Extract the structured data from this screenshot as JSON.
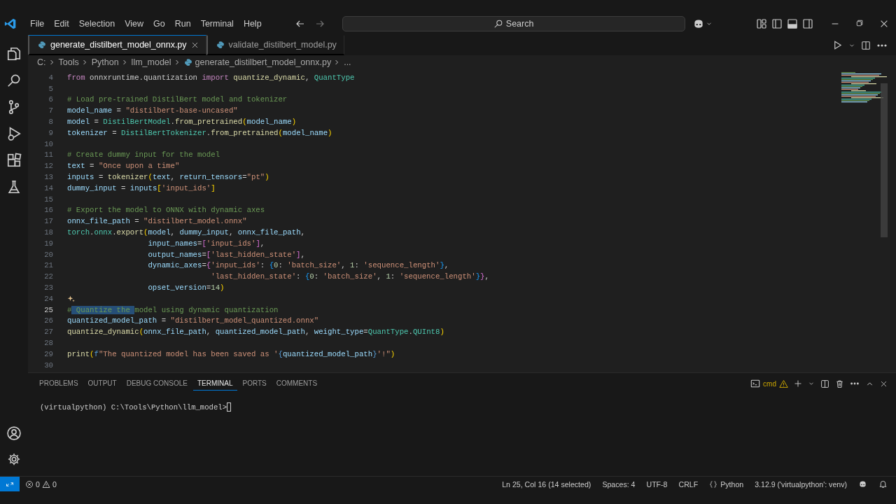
{
  "menu": [
    "File",
    "Edit",
    "Selection",
    "View",
    "Go",
    "Run",
    "Terminal",
    "Help"
  ],
  "search": {
    "placeholder": "Search"
  },
  "tabs": [
    {
      "label": "generate_distilbert_model_onnx.py",
      "selected": true
    },
    {
      "label": "validate_distilbert_model.py",
      "selected": false
    }
  ],
  "breadcrumbs": [
    "C:",
    "Tools",
    "Python",
    "llm_model",
    "generate_distilbert_model_onnx.py",
    "..."
  ],
  "code": [
    {
      "n": "4",
      "current": false,
      "tokens": [
        {
          "text": "from",
          "kind": "kw"
        },
        {
          "text": " onnxruntime.quantization ",
          "kind": "p"
        },
        {
          "text": "import",
          "kind": "kw"
        },
        {
          "text": " quantize_dynamic",
          "kind": "fn"
        },
        {
          "text": ", ",
          "kind": "p"
        },
        {
          "text": "QuantType",
          "kind": "cls"
        }
      ]
    },
    {
      "n": "5",
      "current": false
    },
    {
      "n": "6",
      "current": false,
      "tokens": [
        {
          "text": "# Load pre-trained DistilBert model and tokenizer",
          "kind": "cmt"
        }
      ]
    },
    {
      "n": "7",
      "current": false,
      "tokens": [
        {
          "text": "model_name",
          "kind": "var"
        },
        {
          "text": " = ",
          "kind": "p"
        },
        {
          "text": "\"distilbert-base-uncased\"",
          "kind": "str"
        }
      ]
    },
    {
      "n": "8",
      "current": false,
      "tokens": [
        {
          "text": "model",
          "kind": "var"
        },
        {
          "text": " = ",
          "kind": "p"
        },
        {
          "text": "DistilBertModel",
          "kind": "cls"
        },
        {
          "text": ".",
          "kind": "p"
        },
        {
          "text": "from_pretrained",
          "kind": "fn"
        },
        {
          "text": "(",
          "kind": "b1"
        },
        {
          "text": "model_name",
          "kind": "var"
        },
        {
          "text": ")",
          "kind": "b1"
        }
      ]
    },
    {
      "n": "9",
      "current": false,
      "tokens": [
        {
          "text": "tokenizer",
          "kind": "var"
        },
        {
          "text": " = ",
          "kind": "p"
        },
        {
          "text": "DistilBertTokenizer",
          "kind": "cls"
        },
        {
          "text": ".",
          "kind": "p"
        },
        {
          "text": "from_pretrained",
          "kind": "fn"
        },
        {
          "text": "(",
          "kind": "b1"
        },
        {
          "text": "model_name",
          "kind": "var"
        },
        {
          "text": ")",
          "kind": "b1"
        }
      ]
    },
    {
      "n": "10",
      "current": false
    },
    {
      "n": "11",
      "current": false,
      "tokens": [
        {
          "text": "# Create dummy input for the model",
          "kind": "cmt"
        }
      ]
    },
    {
      "n": "12",
      "current": false,
      "tokens": [
        {
          "text": "text",
          "kind": "var"
        },
        {
          "text": " = ",
          "kind": "p"
        },
        {
          "text": "\"Once upon a time\"",
          "kind": "str"
        }
      ]
    },
    {
      "n": "13",
      "current": false,
      "tokens": [
        {
          "text": "inputs",
          "kind": "var"
        },
        {
          "text": " = ",
          "kind": "p"
        },
        {
          "text": "tokenizer",
          "kind": "fn"
        },
        {
          "text": "(",
          "kind": "b1"
        },
        {
          "text": "text",
          "kind": "var"
        },
        {
          "text": ", ",
          "kind": "p"
        },
        {
          "text": "return_tensors",
          "kind": "var"
        },
        {
          "text": "=",
          "kind": "p"
        },
        {
          "text": "\"pt\"",
          "kind": "str"
        },
        {
          "text": ")",
          "kind": "b1"
        }
      ]
    },
    {
      "n": "14",
      "current": false,
      "tokens": [
        {
          "text": "dummy_input",
          "kind": "var"
        },
        {
          "text": " = ",
          "kind": "p"
        },
        {
          "text": "inputs",
          "kind": "var"
        },
        {
          "text": "[",
          "kind": "b1"
        },
        {
          "text": "'input_ids'",
          "kind": "str"
        },
        {
          "text": "]",
          "kind": "b1"
        }
      ]
    },
    {
      "n": "15",
      "current": false
    },
    {
      "n": "16",
      "current": false,
      "tokens": [
        {
          "text": "# Export the model to ONNX with dynamic axes",
          "kind": "cmt"
        }
      ]
    },
    {
      "n": "17",
      "current": false,
      "tokens": [
        {
          "text": "onnx_file_path",
          "kind": "var"
        },
        {
          "text": " = ",
          "kind": "p"
        },
        {
          "text": "\"distilbert_model.onnx\"",
          "kind": "str"
        }
      ]
    },
    {
      "n": "18",
      "current": false,
      "tokens": [
        {
          "text": "torch",
          "kind": "cls"
        },
        {
          "text": ".",
          "kind": "p"
        },
        {
          "text": "onnx",
          "kind": "cls"
        },
        {
          "text": ".",
          "kind": "p"
        },
        {
          "text": "export",
          "kind": "fn"
        },
        {
          "text": "(",
          "kind": "b1"
        },
        {
          "text": "model",
          "kind": "var"
        },
        {
          "text": ", ",
          "kind": "p"
        },
        {
          "text": "dummy_input",
          "kind": "var"
        },
        {
          "text": ", ",
          "kind": "p"
        },
        {
          "text": "onnx_file_path",
          "kind": "var"
        },
        {
          "text": ",",
          "kind": "p"
        }
      ]
    },
    {
      "n": "19",
      "current": false,
      "kind": "argument",
      "tokens": [
        {
          "text": "input_names",
          "kind": "var"
        },
        {
          "text": "=",
          "kind": "p"
        },
        {
          "text": "[",
          "kind": "b2"
        },
        {
          "text": "'input_ids'",
          "kind": "str"
        },
        {
          "text": "]",
          "kind": "b2"
        },
        {
          "text": ",",
          "kind": "p"
        }
      ]
    },
    {
      "n": "20",
      "current": false,
      "kind": "argument",
      "tokens": [
        {
          "text": "output_names",
          "kind": "var"
        },
        {
          "text": "=",
          "kind": "p"
        },
        {
          "text": "[",
          "kind": "b2"
        },
        {
          "text": "'last_hidden_state'",
          "kind": "str"
        },
        {
          "text": "]",
          "kind": "b2"
        },
        {
          "text": ",",
          "kind": "p"
        }
      ]
    },
    {
      "n": "21",
      "current": false,
      "kind": "argument",
      "tokens": [
        {
          "text": "dynamic_axes",
          "kind": "var"
        },
        {
          "text": "=",
          "kind": "p"
        },
        {
          "text": "{",
          "kind": "b2"
        },
        {
          "text": "'input_ids'",
          "kind": "str"
        },
        {
          "text": ": ",
          "kind": "p"
        },
        {
          "text": "{",
          "kind": "b3"
        },
        {
          "text": "0",
          "kind": "num"
        },
        {
          "text": ": ",
          "kind": "p"
        },
        {
          "text": "'batch_size'",
          "kind": "str"
        },
        {
          "text": ", ",
          "kind": "p"
        },
        {
          "text": "1",
          "kind": "num"
        },
        {
          "text": ": ",
          "kind": "p"
        },
        {
          "text": "'sequence_length'",
          "kind": "str"
        },
        {
          "text": "}",
          "kind": "b3"
        },
        {
          "text": ",",
          "kind": "p"
        }
      ]
    },
    {
      "n": "22",
      "current": false,
      "kind": "nested",
      "tokens": [
        {
          "text": "'last_hidden_state'",
          "kind": "str"
        },
        {
          "text": ": ",
          "kind": "p"
        },
        {
          "text": "{",
          "kind": "b3"
        },
        {
          "text": "0",
          "kind": "num"
        },
        {
          "text": ": ",
          "kind": "p"
        },
        {
          "text": "'batch_size'",
          "kind": "str"
        },
        {
          "text": ", ",
          "kind": "p"
        },
        {
          "text": "1",
          "kind": "num"
        },
        {
          "text": ": ",
          "kind": "p"
        },
        {
          "text": "'sequence_length'",
          "kind": "str"
        },
        {
          "text": "}",
          "kind": "b3"
        },
        {
          "text": "}",
          "kind": "b2"
        },
        {
          "text": ",",
          "kind": "p"
        }
      ]
    },
    {
      "n": "23",
      "current": false,
      "kind": "argument",
      "tokens": [
        {
          "text": "opset_version",
          "kind": "var"
        },
        {
          "text": "=",
          "kind": "p"
        },
        {
          "text": "14",
          "kind": "num"
        },
        {
          "text": ")",
          "kind": "b1"
        }
      ]
    },
    {
      "n": "24",
      "current": false,
      "sparkle": true
    },
    {
      "n": "25",
      "current": true,
      "tokens": [
        {
          "text": "#",
          "kind": "cmt"
        },
        {
          "text": " Quantize the ",
          "kind": "sel"
        },
        {
          "text": "model using dynamic quantization",
          "kind": "cmt"
        }
      ]
    },
    {
      "n": "26",
      "current": false,
      "tokens": [
        {
          "text": "quantized_model_path",
          "kind": "var"
        },
        {
          "text": " = ",
          "kind": "p"
        },
        {
          "text": "\"distilbert_model_quantized.onnx\"",
          "kind": "str"
        }
      ]
    },
    {
      "n": "27",
      "current": false,
      "tokens": [
        {
          "text": "quantize_dynamic",
          "kind": "fn"
        },
        {
          "text": "(",
          "kind": "b1"
        },
        {
          "text": "onnx_file_path",
          "kind": "var"
        },
        {
          "text": ", ",
          "kind": "p"
        },
        {
          "text": "quantized_model_path",
          "kind": "var"
        },
        {
          "text": ", ",
          "kind": "p"
        },
        {
          "text": "weight_type",
          "kind": "var"
        },
        {
          "text": "=",
          "kind": "p"
        },
        {
          "text": "QuantType",
          "kind": "cls"
        },
        {
          "text": ".",
          "kind": "p"
        },
        {
          "text": "QUInt8",
          "kind": "cls"
        },
        {
          "text": ")",
          "kind": "b1"
        }
      ]
    },
    {
      "n": "28",
      "current": false
    },
    {
      "n": "29",
      "current": false,
      "tokens": [
        {
          "text": "print",
          "kind": "fn"
        },
        {
          "text": "(",
          "kind": "b1"
        },
        {
          "text": "f",
          "kind": "kw2"
        },
        {
          "text": "\"The quantized model has been saved as '",
          "kind": "str"
        },
        {
          "text": "{",
          "kind": "kw2"
        },
        {
          "text": "quantized_model_path",
          "kind": "var"
        },
        {
          "text": "}",
          "kind": "kw2"
        },
        {
          "text": "'!\"",
          "kind": "str"
        },
        {
          "text": ")",
          "kind": "b1"
        }
      ]
    },
    {
      "n": "30",
      "current": false
    }
  ],
  "panel": {
    "tabs": [
      {
        "label": "PROBLEMS",
        "selected": false
      },
      {
        "label": "OUTPUT",
        "selected": false
      },
      {
        "label": "DEBUG CONSOLE",
        "selected": false
      },
      {
        "label": "TERMINAL",
        "selected": true
      },
      {
        "label": "PORTS",
        "selected": false
      },
      {
        "label": "COMMENTS",
        "selected": false
      }
    ],
    "shell": "cmd",
    "prompt": "(virtualpython) C:\\Tools\\Python\\llm_model>"
  },
  "status_bar": {
    "errors": "0",
    "warnings": "0",
    "items": [
      "Ln 25, Col 16 (14 selected)",
      "Spaces: 4",
      "UTF-8",
      "CRLF"
    ],
    "language": "Python",
    "interpreter": "3.12.9 ('virtualpython': venv)"
  }
}
